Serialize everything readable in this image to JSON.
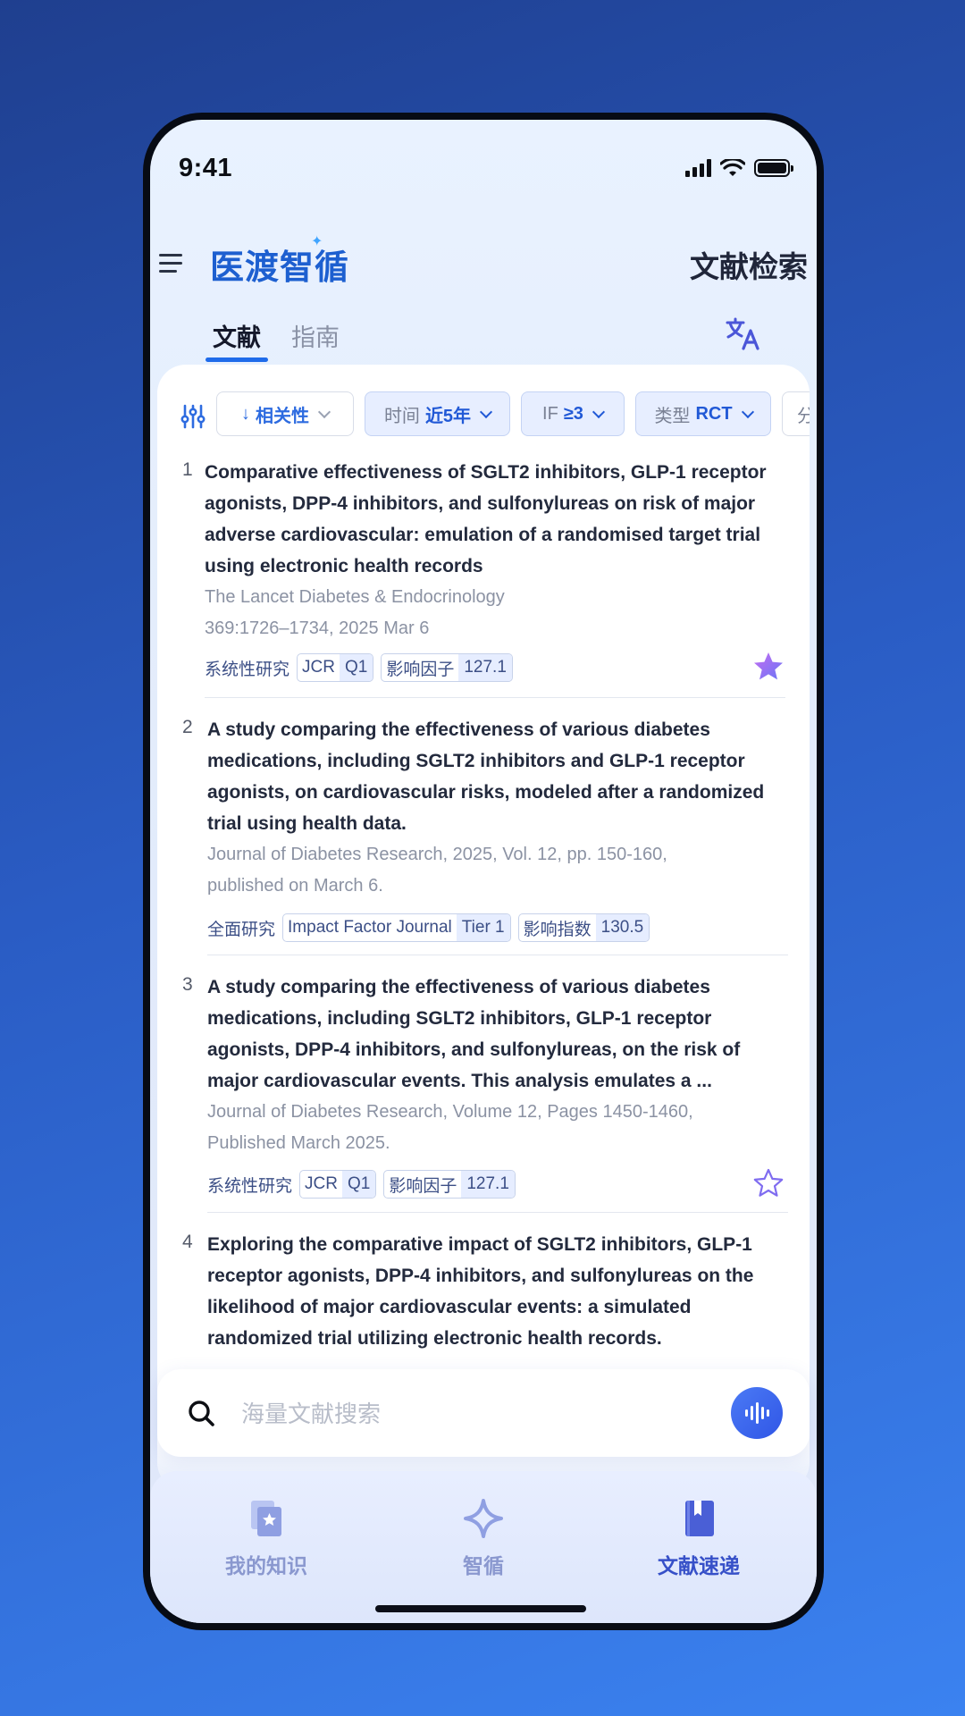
{
  "status_bar": {
    "time": "9:41"
  },
  "header": {
    "menu_icon": "hamburger-menu-icon",
    "logo_text": "医渡智循",
    "page_title": "文献检索"
  },
  "tabs": [
    {
      "label": "文献",
      "active": true
    },
    {
      "label": "指南",
      "active": false
    }
  ],
  "translate_icon": "translate-icon",
  "filters": {
    "settings_icon": "filter-sliders-icon",
    "sort": {
      "label": "相关性"
    },
    "time": {
      "key": "时间",
      "value": "近5年"
    },
    "impact": {
      "key": "IF",
      "value": "≥3"
    },
    "type": {
      "key": "类型",
      "value": "RCT"
    },
    "more": {
      "key": "分"
    }
  },
  "results": [
    {
      "index": "1",
      "title": "Comparative effectiveness of SGLT2 inhibitors, GLP-1 receptor agonists, DPP-4 inhibitors, and sulfonylureas on risk of major adverse cardiovascular: emulation of a randomised target trial using electronic health records",
      "source_line1": "The Lancet Diabetes & Endocrinology",
      "source_line2": "369:1726–1734, 2025 Mar 6",
      "tag_plain": "系统性研究",
      "tag1": {
        "a": "JCR",
        "b": "Q1"
      },
      "tag2": {
        "a": "影响因子",
        "b": "127.1"
      },
      "starred": true
    },
    {
      "index": "2",
      "title": "A study comparing the effectiveness of various diabetes medications, including SGLT2 inhibitors and GLP-1 receptor agonists, on cardiovascular risks, modeled after a randomized trial using health data.",
      "source_line1": "Journal of Diabetes Research, 2025, Vol. 12, pp. 150-160,",
      "source_line2": "published on March 6.",
      "tag_plain": "全面研究",
      "tag1": {
        "a": "Impact Factor Journal",
        "b": "Tier 1"
      },
      "tag2": {
        "a": "影响指数",
        "b": "130.5"
      },
      "starred": null
    },
    {
      "index": "3",
      "title": "A study comparing the effectiveness of various diabetes medications, including SGLT2 inhibitors, GLP-1 receptor agonists, DPP-4 inhibitors, and sulfonylureas, on the risk of major cardiovascular events. This analysis emulates a ...",
      "source_line1": "Journal of Diabetes Research, Volume 12, Pages 1450-1460,",
      "source_line2": "Published March 2025.",
      "tag_plain": "系统性研究",
      "tag1": {
        "a": "JCR",
        "b": "Q1"
      },
      "tag2": {
        "a": "影响因子",
        "b": "127.1"
      },
      "starred": false
    },
    {
      "index": "4",
      "title": "Exploring the comparative impact of SGLT2 inhibitors, GLP-1 receptor agonists, DPP-4 inhibitors, and sulfonylureas on the likelihood of major cardiovascular events: a simulated randomized trial utilizing electronic health records."
    }
  ],
  "search": {
    "placeholder": "海量文献搜索",
    "icon": "search-icon",
    "voice_icon": "voice-waveform-icon"
  },
  "bottom_nav": [
    {
      "label": "我的知识",
      "icon": "knowledge-star-icon",
      "active": false
    },
    {
      "label": "智循",
      "icon": "sparkle-icon",
      "active": false
    },
    {
      "label": "文献速递",
      "icon": "bookmark-book-icon",
      "active": true
    }
  ],
  "colors": {
    "accent": "#1f6bea",
    "brand": "#1d5fd0",
    "star_active": "#8f6cf2"
  }
}
